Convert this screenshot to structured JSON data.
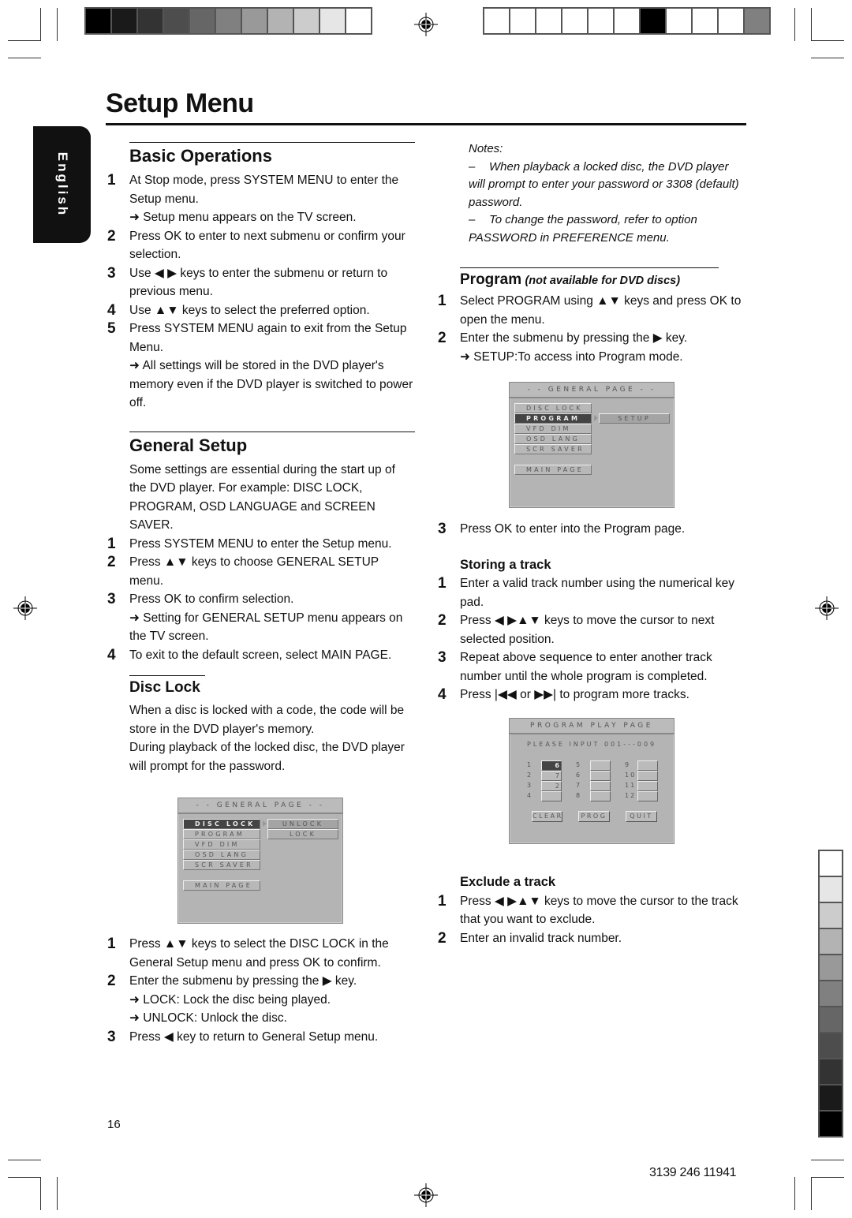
{
  "page": {
    "title": "Setup Menu",
    "language_tab": "English",
    "page_number": "16",
    "document_code": "3139 246 11941",
    "print_marks": {
      "top_bar_left": [
        "#000000",
        "#1a1a1a",
        "#333333",
        "#4d4d4d",
        "#666666",
        "#808080",
        "#999999",
        "#b3b3b3",
        "#cccccc",
        "#e6e6e6",
        "#ffffff"
      ],
      "top_bar_right": [
        "#ffffff",
        "#ffffff",
        "#ffffff",
        "#ffffff",
        "#ffffff",
        "#ffffff",
        "#000000",
        "#ffffff",
        "#ffffff",
        "#ffffff",
        "#808080"
      ],
      "side_bar": [
        "#ffffff",
        "#e6e6e6",
        "#cccccc",
        "#b3b3b3",
        "#999999",
        "#808080",
        "#666666",
        "#4d4d4d",
        "#333333",
        "#1a1a1a",
        "#000000"
      ]
    }
  },
  "basic_operations": {
    "heading": "Basic Operations",
    "steps": [
      {
        "num": "1",
        "text": "At Stop mode, press SYSTEM MENU to enter the Setup menu.",
        "result": "➜ Setup menu appears on the TV screen."
      },
      {
        "num": "2",
        "text": "Press OK to enter to next submenu or confirm your selection."
      },
      {
        "num": "3",
        "text": "Use ◀ ▶ keys to enter the submenu or return to previous menu."
      },
      {
        "num": "4",
        "text": "Use ▲▼ keys to select the preferred option."
      },
      {
        "num": "5",
        "text": "Press SYSTEM MENU again to exit from the Setup Menu.",
        "result": "➜ All settings will be stored in the DVD player's memory even if the DVD player is switched to power off."
      }
    ]
  },
  "general_setup": {
    "heading": "General Setup",
    "intro": "Some settings are essential during the start up of the DVD player. For example: DISC LOCK, PROGRAM, OSD LANGUAGE and SCREEN SAVER.",
    "steps": [
      {
        "num": "1",
        "text": "Press SYSTEM MENU to enter the Setup menu."
      },
      {
        "num": "2",
        "text": "Press ▲▼ keys to choose GENERAL SETUP menu."
      },
      {
        "num": "3",
        "text": "Press OK to confirm selection.",
        "result": "➜ Setting for GENERAL SETUP menu appears on the TV screen."
      },
      {
        "num": "4",
        "text": "To exit to the default screen, select MAIN PAGE."
      }
    ]
  },
  "disc_lock": {
    "heading": "Disc Lock",
    "intro_1": "When a disc is locked with a code, the code will be store in the DVD player's memory.",
    "intro_2": "During playback of the locked disc, the DVD player will prompt for the password.",
    "osd": {
      "header": "- -  GENERAL  PAGE  - -",
      "items": [
        "DISC LOCK",
        "PROGRAM",
        "VFD DIM",
        "OSD LANG",
        "SCR SAVER"
      ],
      "selected_item": "DISC LOCK",
      "main_page": "MAIN PAGE",
      "submenu": [
        "UNLOCK",
        "LOCK"
      ],
      "highlighted_sub": "UNLOCK"
    },
    "steps": [
      {
        "num": "1",
        "text": "Press ▲▼ keys to select the DISC LOCK in the General Setup menu and press OK to confirm."
      },
      {
        "num": "2",
        "text": "Enter the submenu by pressing the ▶ key.",
        "results": [
          "➜ LOCK: Lock the disc being played.",
          "➜ UNLOCK: Unlock the disc."
        ]
      },
      {
        "num": "3",
        "text": "Press ◀ key to return to General Setup menu."
      }
    ]
  },
  "notes": {
    "label": "Notes:",
    "items": [
      "When playback a locked disc, the DVD player will prompt to enter your password or 3308 (default) password.",
      "To change the password, refer to option PASSWORD in PREFERENCE menu."
    ]
  },
  "program": {
    "heading": "Program",
    "heading_note": "(not available for DVD discs)",
    "steps": [
      {
        "num": "1",
        "text": "Select PROGRAM using ▲▼ keys and press OK to open the menu."
      },
      {
        "num": "2",
        "text": "Enter the submenu by pressing the ▶ key.",
        "result": "➜ SETUP:To access into Program mode."
      },
      {
        "num": "3",
        "text": "Press OK to enter into the Program page."
      }
    ],
    "osd": {
      "header": "- -  GENERAL  PAGE  - -",
      "items": [
        "DISC LOCK",
        "PROGRAM",
        "VFD DIM",
        "OSD LANG",
        "SCR SAVER"
      ],
      "selected_item": "PROGRAM",
      "main_page": "MAIN PAGE",
      "submenu": [
        "SETUP"
      ]
    },
    "storing": {
      "heading": "Storing a track",
      "steps": [
        {
          "num": "1",
          "text": "Enter a valid track number using the numerical key pad."
        },
        {
          "num": "2",
          "text": "Press ◀ ▶▲▼ keys to move the cursor to next selected position."
        },
        {
          "num": "3",
          "text": "Repeat above sequence to enter another track number until the whole program is completed."
        },
        {
          "num": "4",
          "text": "Press |◀◀ or ▶▶| to program more tracks."
        }
      ]
    },
    "play_page": {
      "header": "PROGRAM  PLAY  PAGE",
      "prompt": "PLEASE  INPUT  001---009",
      "slots": [
        {
          "label": "1",
          "value": "6",
          "selected": true
        },
        {
          "label": "2",
          "value": "7"
        },
        {
          "label": "3",
          "value": "2"
        },
        {
          "label": "4",
          "value": ""
        },
        {
          "label": "5",
          "value": ""
        },
        {
          "label": "6",
          "value": ""
        },
        {
          "label": "7",
          "value": ""
        },
        {
          "label": "8",
          "value": ""
        },
        {
          "label": "9",
          "value": ""
        },
        {
          "label": "10",
          "value": ""
        },
        {
          "label": "11",
          "value": ""
        },
        {
          "label": "12",
          "value": ""
        }
      ],
      "buttons": [
        "CLEAR",
        "PROG",
        "QUIT"
      ]
    },
    "exclude": {
      "heading": "Exclude a track",
      "steps": [
        {
          "num": "1",
          "text": "Press ◀ ▶▲▼ keys to move the cursor to the track that you want to exclude."
        },
        {
          "num": "2",
          "text": "Enter an invalid track number."
        }
      ]
    }
  }
}
